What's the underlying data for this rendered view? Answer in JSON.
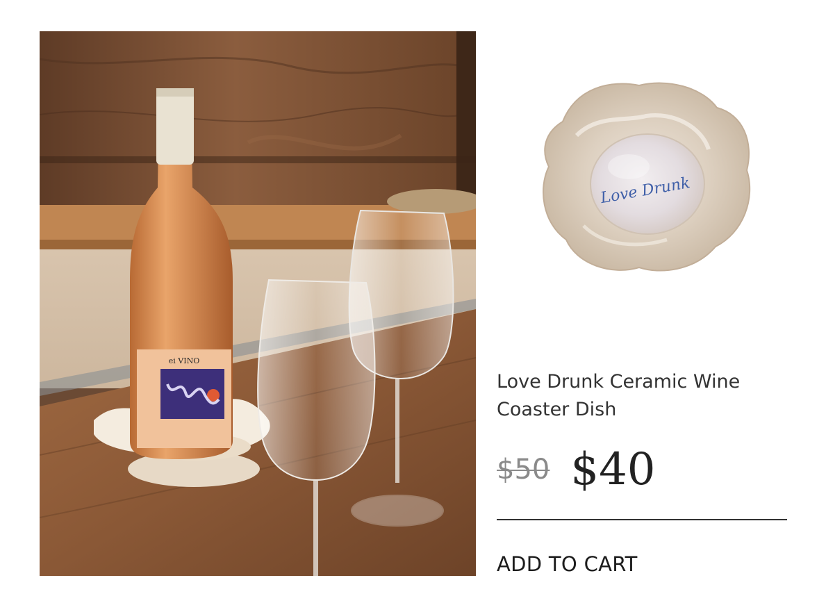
{
  "product": {
    "title": "Love Drunk Ceramic Wine Coaster Dish",
    "price_original": "$50",
    "price_sale": "$40",
    "add_to_cart_label": "ADD TO CART"
  },
  "images": {
    "lifestyle_icon": "product-lifestyle-photo",
    "thumbnail_icon": "product-thumbnail-photo"
  },
  "decor": {
    "bottle_brand": "ei VINO",
    "dish_inscription": "Love Drunk"
  }
}
